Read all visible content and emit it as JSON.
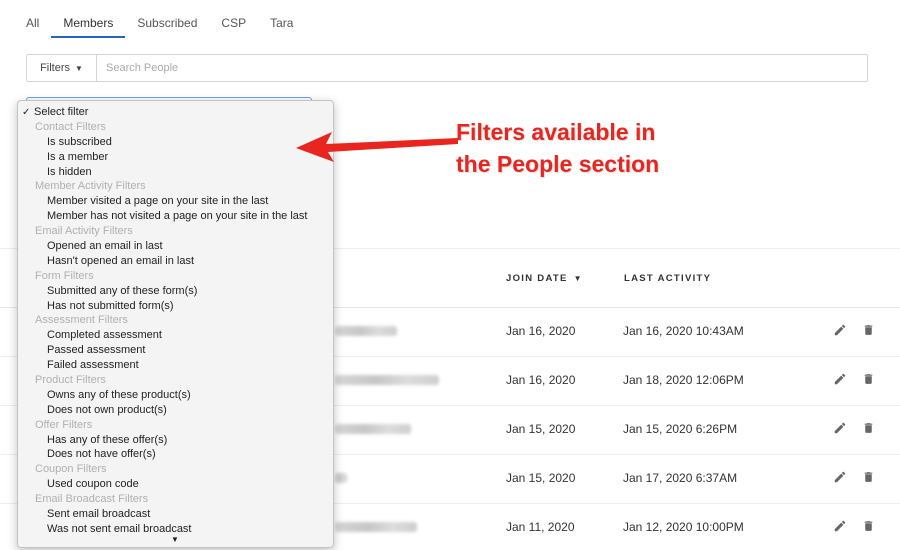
{
  "tabs": [
    {
      "label": "All",
      "active": false
    },
    {
      "label": "Members",
      "active": true
    },
    {
      "label": "Subscribed",
      "active": false
    },
    {
      "label": "CSP",
      "active": false
    },
    {
      "label": "Tara",
      "active": false
    }
  ],
  "filterbar": {
    "filters_label": "Filters",
    "search_placeholder": "Search People"
  },
  "dropdown": {
    "selected": "Select filter",
    "groups": [
      {
        "label": "Contact Filters",
        "options": [
          "Is subscribed",
          "Is a member",
          "Is hidden"
        ]
      },
      {
        "label": "Member Activity Filters",
        "options": [
          "Member visited a page on your site in the last",
          "Member has not visited a page on your site in the last"
        ]
      },
      {
        "label": "Email Activity Filters",
        "options": [
          "Opened an email in last",
          "Hasn't opened an email in last"
        ]
      },
      {
        "label": "Form Filters",
        "options": [
          "Submitted any of these form(s)",
          "Has not submitted form(s)"
        ]
      },
      {
        "label": "Assessment Filters",
        "options": [
          "Completed assessment",
          "Passed assessment",
          "Failed assessment"
        ]
      },
      {
        "label": "Product Filters",
        "options": [
          "Owns any of these product(s)",
          "Does not own product(s)"
        ]
      },
      {
        "label": "Offer Filters",
        "options": [
          "Has any of these offer(s)",
          "Does not have offer(s)"
        ]
      },
      {
        "label": "Coupon Filters",
        "options": [
          "Used coupon code"
        ]
      },
      {
        "label": "Email Broadcast Filters",
        "options": [
          "Sent email broadcast",
          "Was not sent email broadcast"
        ]
      }
    ]
  },
  "table": {
    "columns": {
      "join_date": "JOIN DATE",
      "last_activity": "LAST ACTIVITY"
    },
    "rows": [
      {
        "join_date": "Jan 16, 2020",
        "last_activity": "Jan 16, 2020 10:43AM"
      },
      {
        "join_date": "Jan 16, 2020",
        "last_activity": "Jan 18, 2020 12:06PM"
      },
      {
        "join_date": "Jan 15, 2020",
        "last_activity": "Jan 15, 2020 6:26PM"
      },
      {
        "join_date": "Jan 15, 2020",
        "last_activity": "Jan 17, 2020 6:37AM"
      },
      {
        "join_date": "Jan 11, 2020",
        "last_activity": "Jan 12, 2020 10:00PM"
      }
    ]
  },
  "annotation": {
    "line1": "Filters available in",
    "line2": "the People section"
  },
  "colors": {
    "accent": "#2563c9",
    "annotation": "#e8261f"
  }
}
